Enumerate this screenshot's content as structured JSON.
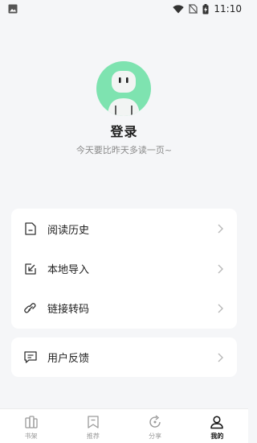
{
  "status_bar": {
    "time": "11:10",
    "icons": [
      "image-notification-icon",
      "wifi-icon",
      "no-sim-icon",
      "battery-charging-icon"
    ]
  },
  "profile": {
    "login_label": "登录",
    "subtitle": "今天要比昨天多读一页~",
    "avatar_color": "#7ee3b0"
  },
  "menu": {
    "items": [
      {
        "label": "阅读历史",
        "icon": "history-doc-icon"
      },
      {
        "label": "本地导入",
        "icon": "import-icon"
      },
      {
        "label": "链接转码",
        "icon": "link-icon"
      }
    ],
    "feedback": {
      "label": "用户反馈",
      "icon": "feedback-message-icon"
    }
  },
  "bottom_nav": {
    "tabs": [
      {
        "label": "书架",
        "icon": "bookshelf-icon"
      },
      {
        "label": "推荐",
        "icon": "recommend-bookmark-icon"
      },
      {
        "label": "分享",
        "icon": "share-refresh-icon"
      },
      {
        "label": "我的",
        "icon": "profile-user-icon",
        "active": true
      }
    ]
  },
  "colors": {
    "background": "#f5f6f8",
    "card": "#ffffff",
    "accent_green": "#7ee3b0",
    "muted_text": "#8a8a8a",
    "active_tab": "#111111",
    "inactive_tab": "#9a9a9a"
  }
}
